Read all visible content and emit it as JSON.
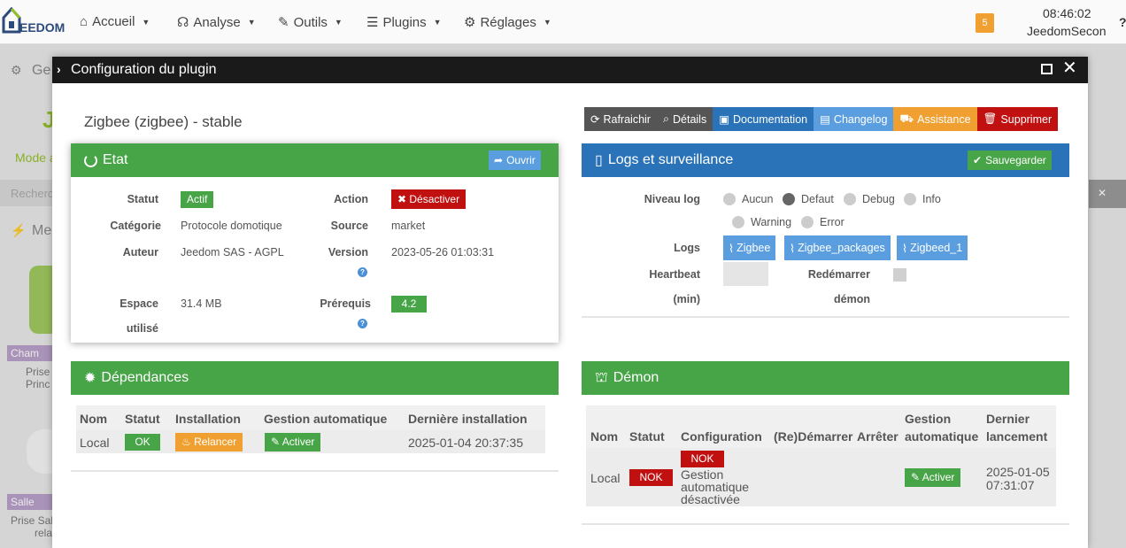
{
  "navbar": {
    "logo_text": "EEDOM",
    "items": [
      {
        "icon": "home-icon",
        "label": "Accueil"
      },
      {
        "icon": "stethoscope-icon",
        "label": "Analyse"
      },
      {
        "icon": "wrench-icon",
        "label": "Outils"
      },
      {
        "icon": "list-icon",
        "label": "Plugins"
      },
      {
        "icon": "gear-icon",
        "label": "Réglages"
      }
    ],
    "notification_count": "5",
    "time": "08:46:02",
    "user": "JeedomSecon"
  },
  "background": {
    "heading1": "Ge",
    "mode_text": "Mode a",
    "search_text": "Recherc",
    "heading2": "Me",
    "tag1": "Cham",
    "item1_line1": "Prise",
    "item1_line2": "Princ",
    "tag2": "Salle",
    "item2_line1": "Prise Sal",
    "item2_line2": "rela",
    "right_text": "✕"
  },
  "modal": {
    "title": "Configuration du plugin",
    "plugin_name": "Zigbee (zigbee) - stable",
    "toolbar": {
      "refresh": "Rafraichir",
      "details": "Détails",
      "documentation": "Documentation",
      "changelog": "Changelog",
      "assistance": "Assistance",
      "delete": "Supprimer"
    },
    "etat": {
      "title": "Etat",
      "open_button": "Ouvrir",
      "statut_label": "Statut",
      "statut_value": "Actif",
      "action_label": "Action",
      "action_button": "Désactiver",
      "categorie_label": "Catégorie",
      "categorie_value": "Protocole domotique",
      "source_label": "Source",
      "source_value": "market",
      "auteur_label": "Auteur",
      "auteur_value": "Jeedom SAS - AGPL",
      "version_label": "Version",
      "version_value": "2023-05-26 01:03:31",
      "espace_label_1": "Espace",
      "espace_label_2": "utilisé",
      "espace_value": "31.4 MB",
      "prerequis_label": "Prérequis",
      "prerequis_value": "4.2"
    },
    "logs": {
      "title": "Logs et surveillance",
      "save_button": "Sauvegarder",
      "niveau_label": "Niveau log",
      "levels": [
        "Aucun",
        "Defaut",
        "Debug",
        "Info",
        "Warning",
        "Error"
      ],
      "selected_level": "Defaut",
      "logs_label": "Logs",
      "log_buttons": [
        "Zigbee",
        "Zigbee_packages",
        "Zigbeed_1"
      ],
      "heartbeat_label_1": "Heartbeat",
      "heartbeat_label_2": "(min)",
      "restart_label_1": "Redémarrer",
      "restart_label_2": "démon"
    },
    "deps": {
      "title": "Dépendances",
      "headers": [
        "Nom",
        "Statut",
        "Installation",
        "Gestion automatique",
        "Dernière installation"
      ],
      "row": {
        "nom": "Local",
        "statut": "OK",
        "installation": "Relancer",
        "gestion": "Activer",
        "derniere": "2025-01-04 20:37:35"
      }
    },
    "demon": {
      "title": "Démon",
      "headers": {
        "nom": "Nom",
        "statut": "Statut",
        "configuration": "Configuration",
        "redemarrer": "(Re)Démarrer",
        "arreter": "Arrêter",
        "gestion_1": "Gestion",
        "gestion_2": "automatique",
        "dernier_1": "Dernier",
        "dernier_2": "lancement"
      },
      "row": {
        "nom": "Local",
        "statut": "NOK",
        "config_badge": "NOK",
        "config_text_1": "Gestion",
        "config_text_2": "automatique",
        "config_text_3": "désactivée",
        "gestion": "Activer",
        "dernier_1": "2025-01-05",
        "dernier_2": "07:31:07"
      }
    }
  }
}
